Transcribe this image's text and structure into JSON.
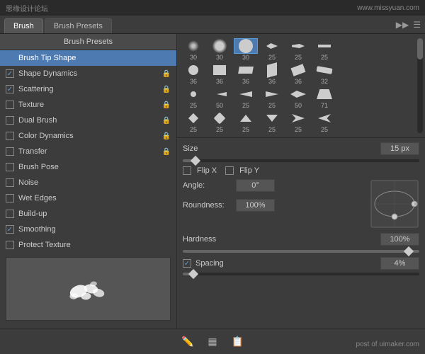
{
  "watermark": {
    "left": "思缘设计论坛",
    "right": "www.missyuan.com"
  },
  "tabs": {
    "items": [
      {
        "label": "Brush",
        "active": true
      },
      {
        "label": "Brush Presets",
        "active": false
      }
    ],
    "icon1": "▶▶",
    "icon2": "☰"
  },
  "sidebar": {
    "header": "Brush Presets",
    "items": [
      {
        "label": "Brush Tip Shape",
        "type": "plain",
        "checked": false,
        "lock": false
      },
      {
        "label": "Shape Dynamics",
        "type": "checkbox",
        "checked": true,
        "lock": true,
        "active": false
      },
      {
        "label": "Scattering",
        "type": "checkbox",
        "checked": true,
        "lock": true
      },
      {
        "label": "Texture",
        "type": "checkbox",
        "checked": false,
        "lock": true
      },
      {
        "label": "Dual Brush",
        "type": "checkbox",
        "checked": false,
        "lock": true
      },
      {
        "label": "Color Dynamics",
        "type": "checkbox",
        "checked": false,
        "lock": true
      },
      {
        "label": "Transfer",
        "type": "checkbox",
        "checked": false,
        "lock": true
      },
      {
        "label": "Brush Pose",
        "type": "checkbox",
        "checked": false,
        "lock": false
      },
      {
        "label": "Noise",
        "type": "checkbox",
        "checked": false,
        "lock": false
      },
      {
        "label": "Wet Edges",
        "type": "checkbox",
        "checked": false,
        "lock": false
      },
      {
        "label": "Build-up",
        "type": "checkbox",
        "checked": false,
        "lock": false
      },
      {
        "label": "Smoothing",
        "type": "checkbox",
        "checked": true,
        "lock": false
      },
      {
        "label": "Protect Texture",
        "type": "checkbox",
        "checked": false,
        "lock": false
      }
    ]
  },
  "brush_grid": {
    "rows": [
      {
        "cells": [
          {
            "size": "30",
            "type": "soft-sm"
          },
          {
            "size": "30",
            "type": "soft-md"
          },
          {
            "size": "30",
            "type": "circle",
            "selected": true
          },
          {
            "size": "25",
            "type": "arrow-r"
          },
          {
            "size": "25",
            "type": "arrow-r2"
          },
          {
            "size": "25",
            "type": "dash"
          }
        ]
      },
      {
        "cells": [
          {
            "size": "36",
            "type": "circle-sm"
          },
          {
            "size": "36",
            "type": "rect"
          },
          {
            "size": "36",
            "type": "rect2"
          },
          {
            "size": "36",
            "type": "rect3"
          },
          {
            "size": "36",
            "type": "rect4"
          },
          {
            "size": "32",
            "type": "rect5"
          }
        ]
      },
      {
        "cells": [
          {
            "size": "25",
            "type": "dot"
          },
          {
            "size": "50",
            "type": "arrow-l"
          },
          {
            "size": "25",
            "type": "arrow-l2"
          },
          {
            "size": "25",
            "type": "arrow-l3"
          },
          {
            "size": "50",
            "type": "arrow-l4"
          },
          {
            "size": "71",
            "type": "arrow-l5"
          }
        ]
      },
      {
        "cells": [
          {
            "size": "25",
            "type": "dot2"
          },
          {
            "size": "25",
            "type": "dot3"
          },
          {
            "size": "25",
            "type": "dot4"
          },
          {
            "size": "25",
            "type": "dot5"
          },
          {
            "size": "25",
            "type": "dot6"
          },
          {
            "size": "25",
            "type": "dot7"
          }
        ]
      }
    ]
  },
  "settings": {
    "size": {
      "label": "Size",
      "value": "15 px",
      "slider_pct": 5
    },
    "flip_x": {
      "label": "Flip X",
      "checked": false
    },
    "flip_y": {
      "label": "Flip Y",
      "checked": false
    },
    "angle": {
      "label": "Angle:",
      "value": "0°"
    },
    "roundness": {
      "label": "Roundness:",
      "value": "100%"
    },
    "hardness": {
      "label": "Hardness",
      "value": "100%",
      "slider_pct": 100
    },
    "spacing": {
      "label": "Spacing",
      "value": "4%",
      "checked": true,
      "slider_pct": 4
    }
  },
  "toolbar": {
    "icons": [
      "🖊",
      "▦",
      "📋"
    ]
  },
  "post_label": "post of uimaker.com"
}
